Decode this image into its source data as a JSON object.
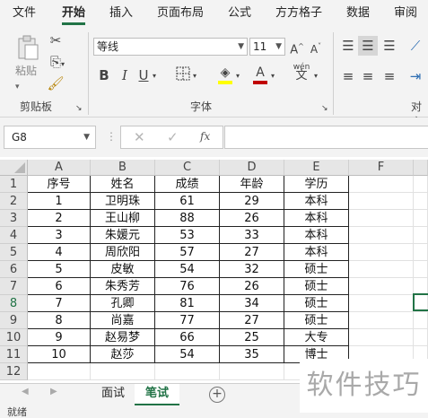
{
  "ribbon_tabs": [
    "文件",
    "开始",
    "插入",
    "页面布局",
    "公式",
    "方方格子",
    "数据",
    "审阅"
  ],
  "active_tab": "开始",
  "clipboard": {
    "paste_label": "粘贴",
    "group_label": "剪贴板"
  },
  "font": {
    "name": "等线",
    "size": "11",
    "group_label": "字体",
    "bold": "B",
    "italic": "I",
    "underline": "U",
    "grow": "A^",
    "shrink": "A˅",
    "color_letter": "A",
    "pinyin": "wén"
  },
  "alignment": {
    "group_label_partial": "对齐"
  },
  "formula_bar": {
    "name_box": "G8",
    "fx": "fx",
    "value": ""
  },
  "columns": [
    "A",
    "B",
    "C",
    "D",
    "E",
    "F"
  ],
  "rows": [
    "1",
    "2",
    "3",
    "4",
    "5",
    "6",
    "7",
    "8",
    "9",
    "10",
    "11",
    "12"
  ],
  "selected_row": "8",
  "table": {
    "headers": [
      "序号",
      "姓名",
      "成绩",
      "年龄",
      "学历"
    ],
    "rows": [
      [
        "1",
        "卫明珠",
        "61",
        "29",
        "本科"
      ],
      [
        "2",
        "王山柳",
        "88",
        "26",
        "本科"
      ],
      [
        "3",
        "朱媛元",
        "53",
        "33",
        "本科"
      ],
      [
        "4",
        "周欣阳",
        "57",
        "27",
        "本科"
      ],
      [
        "5",
        "皮敏",
        "54",
        "32",
        "硕士"
      ],
      [
        "6",
        "朱秀芳",
        "76",
        "26",
        "硕士"
      ],
      [
        "7",
        "孔卿",
        "81",
        "34",
        "硕士"
      ],
      [
        "8",
        "尚嘉",
        "77",
        "27",
        "硕士"
      ],
      [
        "9",
        "赵易梦",
        "66",
        "25",
        "大专"
      ],
      [
        "10",
        "赵莎",
        "54",
        "35",
        "博士"
      ]
    ]
  },
  "sheets": [
    "面试",
    "笔试"
  ],
  "active_sheet": "笔试",
  "status": "就绪",
  "watermark": "软件技巧",
  "colors": {
    "accent": "#217346",
    "font_color_bar": "#c00000",
    "fill_color_bar": "#ffff00"
  }
}
